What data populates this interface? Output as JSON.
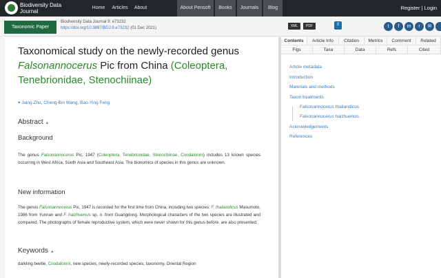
{
  "topbar": {
    "logo_text": "Biodiversity Data Journal",
    "nav": [
      "Home",
      "Articles",
      "About",
      "About Pensoft",
      "Books",
      "Journals",
      "Blog"
    ],
    "register": "Register",
    "login": "Login",
    "separator": "|"
  },
  "header": {
    "type_button": "Taxonomic Paper",
    "journal_line": "Biodiversity Data Journal 9: e73232",
    "doi_link": "https://doi.org/10.3897/BDJ.9.e73232",
    "date": "(01 Dec 2021)",
    "xml_label": "XML",
    "pdf_label": "PDF",
    "comments_count": "0",
    "social_icons": [
      "twitter-icon",
      "facebook-icon",
      "mendeley-icon",
      "reddit-icon",
      "email-icon",
      "plus-icon"
    ]
  },
  "article": {
    "title_prefix": "Taxonomical study on the newly-recorded genus ",
    "title_genus": "Falsonannocerus",
    "title_suffix": " Pic from China",
    "title_taxa": "(Coleoptera, Tenebrionidae, Stenochiinae)",
    "authors": "Jiang Zhu, Cheng-Bin Wang, Bao-Ying Feng",
    "abstract_heading": "Abstract",
    "background_heading": "Background",
    "background_p1_a": "The genus ",
    "background_genus": "Falsonannocerus",
    "background_p1_b": " Pic, 1947 (",
    "background_taxa": "Coleoptera, Tenebrionidae, Stenochiinae, Cnodalonini",
    "background_p1_c": ") includes 13 known species occurring in West Africa, South Asia and Southeast Asia. The bionomics of species in this genus are unknown.",
    "newinfo_heading": "New information",
    "newinfo_a": "The genus ",
    "newinfo_genus": "Falsonannocerus",
    "newinfo_b": " Pic, 1947 is recorded for the first time from China, including two species: ",
    "newinfo_sp1": "F. thailandicus",
    "newinfo_c": " Masumoto, 1986 from Yunnan and ",
    "newinfo_sp2": "F. haizhuensis",
    "newinfo_d": " sp. n. from Guangdong. Morphological characters of the two species are illustrated and compared. The photographs of female reproductive system, which were never shown for this genus before, are also presented.",
    "keywords_heading": "Keywords",
    "keywords_a": "darkling beetle, ",
    "keywords_link": "Cnodalonini",
    "keywords_b": ", new species, newly-recorded species, taxonomy, Oriental Region"
  },
  "sidebar": {
    "tabs_row1": [
      "Contents",
      "Article Info",
      "Citation",
      "Metrics",
      "Comment",
      "Related"
    ],
    "tabs_row2": [
      "Figs",
      "Taxa",
      "Data",
      "Refs",
      "Cited"
    ],
    "toc": [
      "Article metadata",
      "Introduction",
      "Materials and methods",
      "Taxon treatments",
      "Falsonannocerus thailandicus",
      "Falsonannocerus haizhuensis",
      "Acknowledgements",
      "References"
    ]
  }
}
